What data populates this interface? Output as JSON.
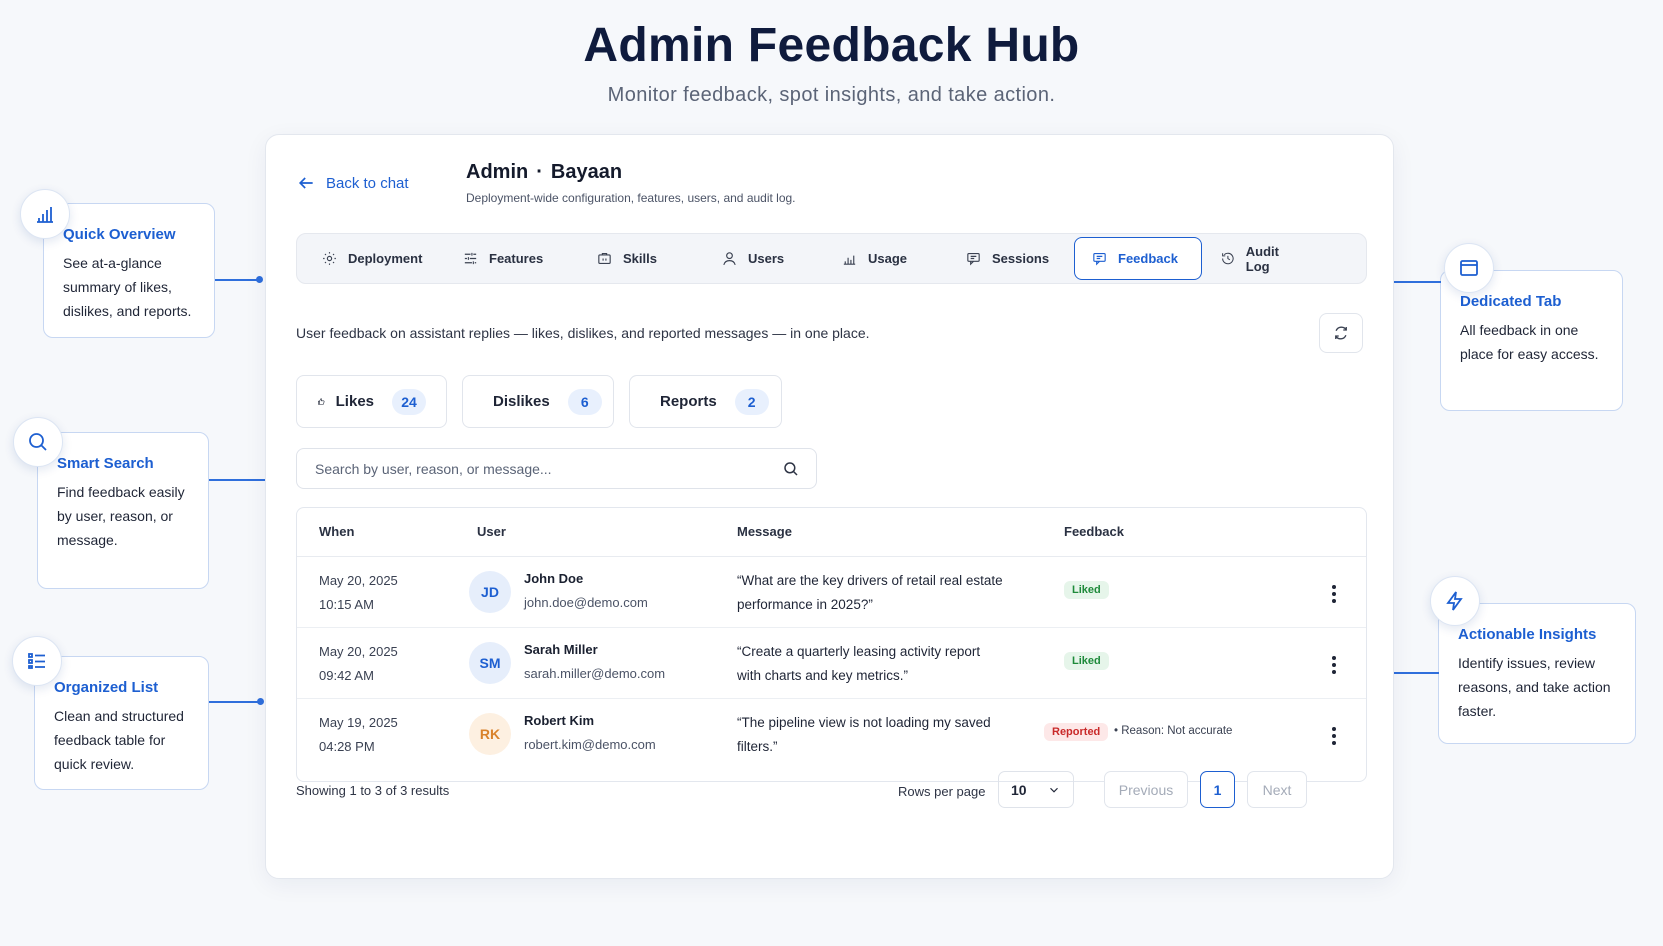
{
  "hero": {
    "title": "Admin Feedback Hub",
    "subtitle": "Monitor feedback, spot insights, and take action."
  },
  "header": {
    "back_label": "Back to chat",
    "title_left": "Admin",
    "title_sep": "·",
    "title_right": "Bayaan",
    "subtitle": "Deployment-wide configuration, features, users, and audit log."
  },
  "tabs": [
    {
      "label": "Deployment",
      "icon": "gear-icon"
    },
    {
      "label": "Features",
      "icon": "sliders-icon"
    },
    {
      "label": "Skills",
      "icon": "briefcase-icon"
    },
    {
      "label": "Users",
      "icon": "user-icon"
    },
    {
      "label": "Usage",
      "icon": "bar-chart-icon"
    },
    {
      "label": "Sessions",
      "icon": "chat-icon"
    },
    {
      "label": "Feedback",
      "icon": "message-icon",
      "active": true
    },
    {
      "label": "Audit Log",
      "icon": "history-icon"
    }
  ],
  "feedback": {
    "description": "User feedback on assistant replies — likes, dislikes, and reported messages — in one place.",
    "stats": [
      {
        "label": "Likes",
        "count": "24",
        "icon": "thumbs-up-icon"
      },
      {
        "label": "Dislikes",
        "count": "6",
        "icon": "thumbs-down-icon"
      },
      {
        "label": "Reports",
        "count": "2",
        "icon": "flag-icon"
      }
    ],
    "search_placeholder": "Search by user, reason, or message..."
  },
  "table": {
    "columns": [
      "When",
      "User",
      "Message",
      "Feedback"
    ],
    "rows": [
      {
        "date": "May 20, 2025",
        "time": "10:15 AM",
        "initials": "JD",
        "name": "John Doe",
        "email": "john.doe@demo.com",
        "message": "“What are the key drivers of retail real estate performance in 2025?”",
        "feedback": "Liked",
        "reason": ""
      },
      {
        "date": "May 20, 2025",
        "time": "09:42 AM",
        "initials": "SM",
        "name": "Sarah Miller",
        "email": "sarah.miller@demo.com",
        "message": "“Create a quarterly leasing activity report with charts and key metrics.”",
        "feedback": "Liked",
        "reason": ""
      },
      {
        "date": "May 19, 2025",
        "time": "04:28 PM",
        "initials": "RK",
        "name": "Robert Kim",
        "email": "robert.kim@demo.com",
        "message": "“The pipeline view is not loading my saved filters.”",
        "feedback": "Reported",
        "reason": "• Reason: Not accurate"
      }
    ]
  },
  "pagination": {
    "summary": "Showing 1 to 3 of 3 results",
    "rows_per_page_label": "Rows per page",
    "rows_per_page": "10",
    "previous": "Previous",
    "page": "1",
    "next": "Next"
  },
  "callouts": {
    "quick_overview": {
      "title": "Quick Overview",
      "body": "See at-a-glance summary of likes, dislikes, and reports."
    },
    "smart_search": {
      "title": "Smart Search",
      "body": "Find feedback easily by user, reason, or message."
    },
    "organized_list": {
      "title": "Organized List",
      "body": "Clean and structured feedback table for quick review."
    },
    "dedicated_tab": {
      "title": "Dedicated Tab",
      "body": "All feedback in one place for easy access."
    },
    "actionable_insights": {
      "title": "Actionable Insights",
      "body": "Identify issues, review reasons, and take action faster."
    }
  },
  "colors": {
    "accent": "#1d5fd1",
    "liked": "#1e8a3a",
    "reported": "#c92a2a"
  }
}
